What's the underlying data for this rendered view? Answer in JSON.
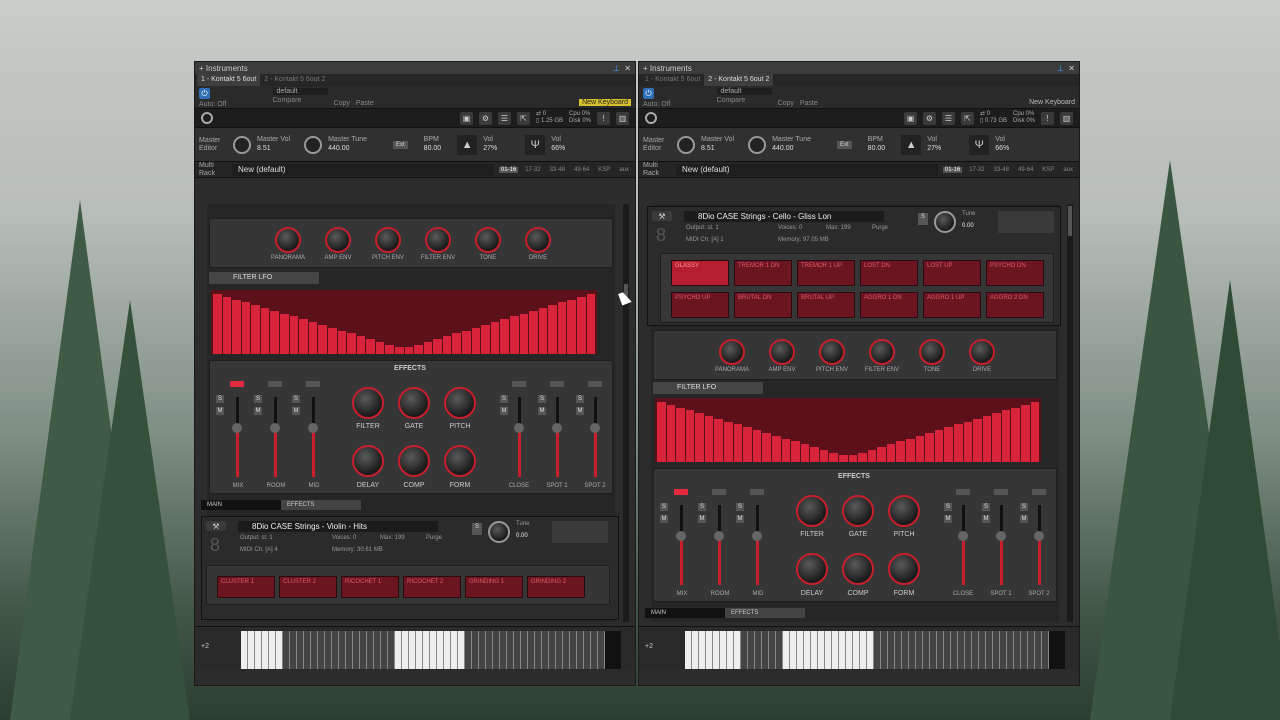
{
  "colors": {
    "accent": "#c81f2e",
    "highlight": "#d7c12f",
    "power": "#2e6fb5"
  },
  "windows": [
    {
      "title": "Instruments",
      "tabs": [
        "1 - Kontakt 5 6out",
        "2 - Kontakt 5 6out 2"
      ],
      "preset": "default",
      "auto": "Auto: Off",
      "compare": "Compare",
      "copy": "Copy",
      "paste": "Paste",
      "new_keyboard": "New Keyboard",
      "stats": {
        "midi": "0",
        "mem": "1.25 GB",
        "cpu": "0%",
        "disk": "0%"
      },
      "master_editor": "Master Editor",
      "master_vol_label": "Master Vol",
      "master_vol": "8.51",
      "master_tune_label": "Master Tune",
      "master_tune": "440.00",
      "ext": "Ext",
      "bpm_label": "BPM",
      "bpm": "80.00",
      "vol_label": "Vol",
      "vol": "27%",
      "vol2_label": "Vol",
      "vol2": "66%",
      "multi_rack": "Multi Rack",
      "rack_title": "New (default)",
      "rack_tabs": [
        "01-16",
        "17-32",
        "33-48",
        "49-64",
        "KSP",
        "aux"
      ],
      "knobs": [
        "PANORAMA",
        "AMP ENV",
        "PITCH ENV",
        "FILTER ENV",
        "TONE",
        "DRIVE"
      ],
      "filter_lfo": "FILTER LFO",
      "effects": "EFFECTS",
      "faders_left": [
        "MIX",
        "ROOM",
        "MID"
      ],
      "fx_top": [
        "FILTER",
        "GATE",
        "PITCH"
      ],
      "fx_bot": [
        "DELAY",
        "COMP",
        "FORM"
      ],
      "faders_right": [
        "CLOSE",
        "SPOT 1",
        "SPOT 2"
      ],
      "bottom_tabs": [
        "MAIN",
        "EFFECTS"
      ],
      "instrument": {
        "name": "8Dio CASE Strings - Violin - Hits",
        "output": "st. 1",
        "voices": "0",
        "max": "199",
        "purge": "Purge",
        "midi": "[A] 4",
        "memory": "30.61 MB",
        "tune_label": "Tune",
        "tune": "0.00",
        "output_label": "Output:",
        "voices_label": "Voices:",
        "max_label": "Max:",
        "midi_label": "MIDI Ch:",
        "memory_label": "Memory:"
      },
      "articulations": [
        "CLUSTER 1",
        "CLUSTER 2",
        "RICOCHET 1",
        "RICOCHET 2",
        "GRINDING 1",
        "GRINDING 2"
      ],
      "kbd_oct": "+2"
    },
    {
      "title": "Instruments",
      "tabs": [
        "1 - Kontakt 5 6out",
        "2 - Kontakt 5 6out 2"
      ],
      "preset": "default",
      "auto": "Auto: Off",
      "compare": "Compare",
      "copy": "Copy",
      "paste": "Paste",
      "new_keyboard": "New Keyboard",
      "stats": {
        "midi": "0",
        "mem": "0.73 GB",
        "cpu": "0%",
        "disk": "0%"
      },
      "master_editor": "Master Editor",
      "master_vol_label": "Master Vol",
      "master_vol": "8.51",
      "master_tune_label": "Master Tune",
      "master_tune": "440.00",
      "ext": "Ext",
      "bpm_label": "BPM",
      "bpm": "80.00",
      "vol_label": "Vol",
      "vol": "27%",
      "vol2_label": "Vol",
      "vol2": "66%",
      "multi_rack": "Multi Rack",
      "rack_title": "New (default)",
      "rack_tabs": [
        "01-16",
        "17-32",
        "33-48",
        "49-64",
        "KSP",
        "aux"
      ],
      "knobs": [
        "PANORAMA",
        "AMP ENV",
        "PITCH ENV",
        "FILTER ENV",
        "TONE",
        "DRIVE"
      ],
      "filter_lfo": "FILTER LFO",
      "effects": "EFFECTS",
      "faders_left": [
        "MIX",
        "ROOM",
        "MID"
      ],
      "fx_top": [
        "FILTER",
        "GATE",
        "PITCH"
      ],
      "fx_bot": [
        "DELAY",
        "COMP",
        "FORM"
      ],
      "faders_right": [
        "CLOSE",
        "SPOT 1",
        "SPOT 2"
      ],
      "bottom_tabs": [
        "MAIN",
        "EFFECTS"
      ],
      "instrument": {
        "name": "8Dio CASE Strings - Cello - Gliss Lon",
        "output": "st. 1",
        "voices": "0",
        "max": "199",
        "purge": "Purge",
        "midi": "[A] 1",
        "memory": "97.05 MB",
        "tune_label": "Tune",
        "tune": "0.00",
        "output_label": "Output:",
        "voices_label": "Voices:",
        "max_label": "Max:",
        "midi_label": "MIDI Ch:",
        "memory_label": "Memory:"
      },
      "articulations": [
        "GLASSY",
        "TREMOR 1 DN",
        "TREMOR 1 UP",
        "LOST DN",
        "LOST UP",
        "PSYCHO DN",
        "PSYCHO UP",
        "BRUTAL DN",
        "BRUTAL UP",
        "AGGRO 1 DN",
        "AGGRO 1 UP",
        "AGGRO 2 DN"
      ],
      "kbd_oct": "+2"
    }
  ]
}
